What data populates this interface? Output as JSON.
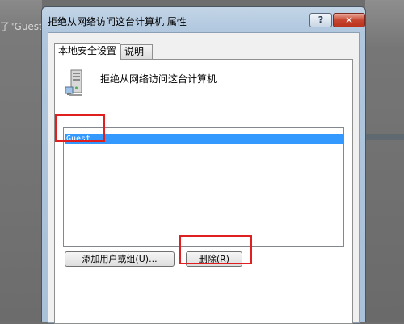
{
  "background": {
    "left_text": "了\"Guest\"d"
  },
  "dialog": {
    "title": "拒绝从网络访问这台计算机 属性",
    "help_label": "?",
    "close_label": "✕",
    "tabs": [
      {
        "label": "本地安全设置",
        "active": true
      },
      {
        "label": "说明",
        "active": false
      }
    ],
    "policy_name": "拒绝从网络访问这台计算机",
    "policy_icon": "server-computer-icon",
    "accounts": [
      "Guest"
    ],
    "selected_account": "Guest",
    "buttons": {
      "add": "添加用户或组(U)...",
      "remove": "删除(R)"
    }
  },
  "annotations": {
    "color": "#e02020",
    "highlights": [
      "guest-list-item",
      "remove-button"
    ]
  }
}
